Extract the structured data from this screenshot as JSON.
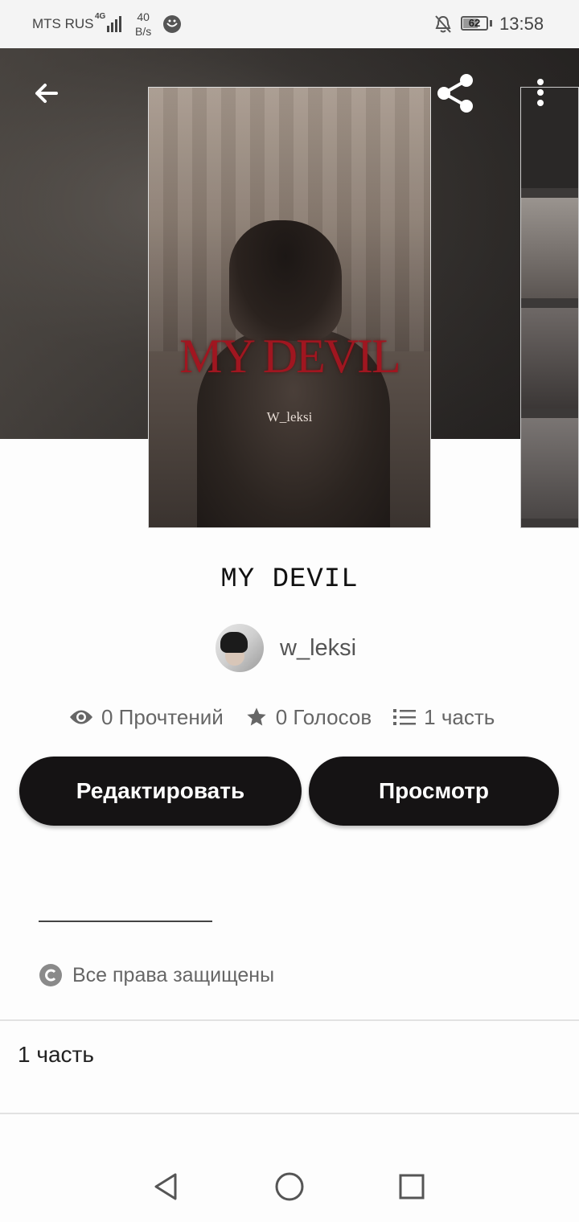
{
  "status_bar": {
    "carrier": "MTS RUS",
    "network": "4G",
    "speed_value": "40",
    "speed_unit": "B/s",
    "battery": "62",
    "time": "13:58"
  },
  "toolbar": {
    "back_icon": "arrow-left-icon",
    "share_icon": "share-icon",
    "more_icon": "more-vertical-icon"
  },
  "cover": {
    "title_text": "MY DEVIL",
    "author_text": "W_leksi"
  },
  "story": {
    "title": "MY DEVIL",
    "author": "w_leksi"
  },
  "stats": {
    "reads": "0 Прочтений",
    "votes": "0 Голосов",
    "parts": "1 часть"
  },
  "actions": {
    "edit_label": "Редактировать",
    "view_label": "Просмотр"
  },
  "copyright": {
    "text": "Все права защищены"
  },
  "parts_list": {
    "item_label": "1 часть"
  },
  "nav": {
    "back": "nav-back-icon",
    "home": "nav-home-icon",
    "recents": "nav-recents-icon"
  }
}
